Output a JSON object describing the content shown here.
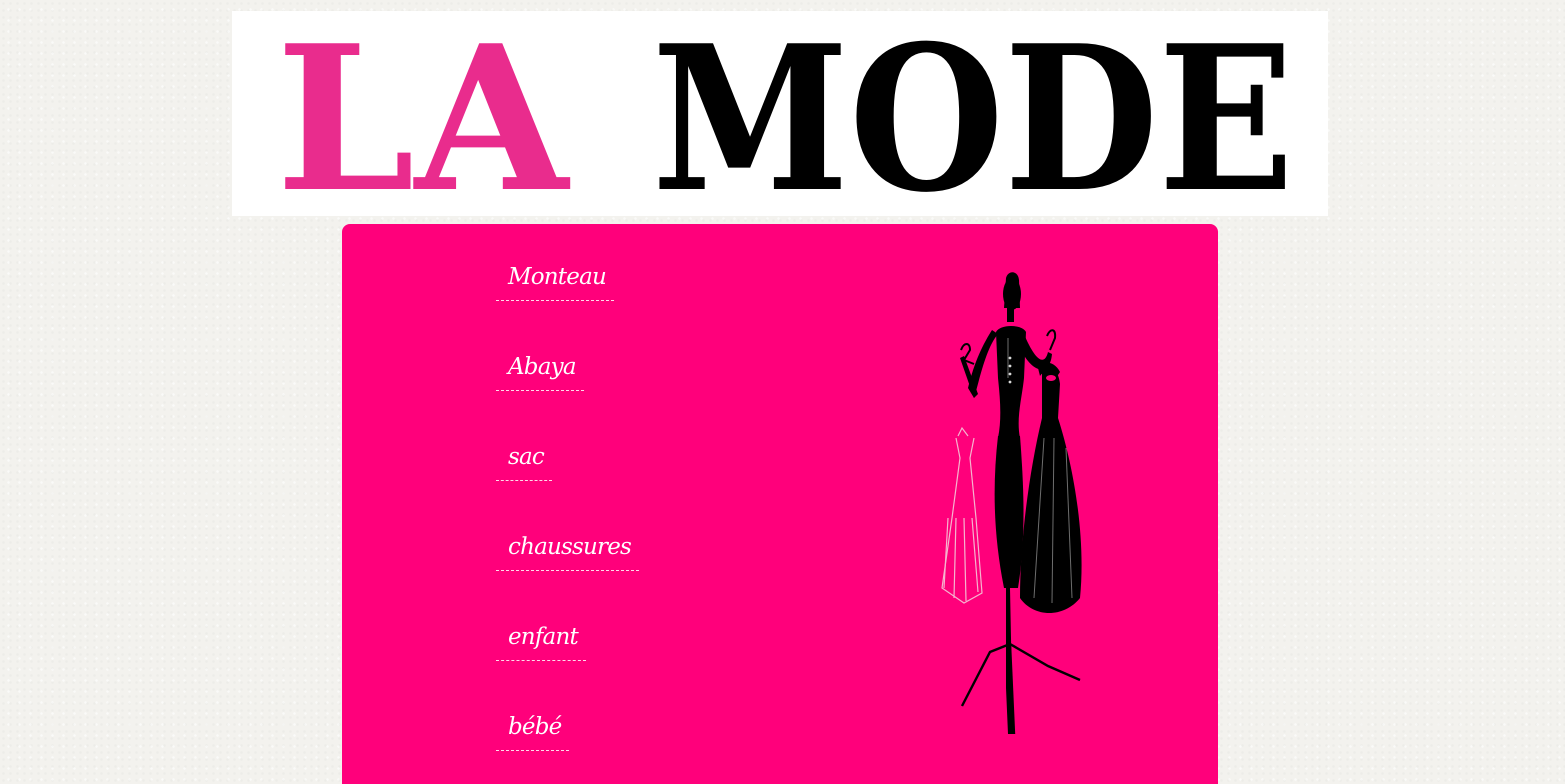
{
  "logo": {
    "word1": "LA",
    "word2": "MODE",
    "word1_color": "#e92c8d",
    "word2_color": "#000000"
  },
  "panel": {
    "background": "#ff007b"
  },
  "nav": {
    "items": [
      {
        "label": "Monteau"
      },
      {
        "label": "Abaya"
      },
      {
        "label": "sac"
      },
      {
        "label": "chaussures"
      },
      {
        "label": "enfant"
      },
      {
        "label": "bébé"
      }
    ]
  },
  "illustration": {
    "icon": "dress-form-silhouette-icon"
  }
}
